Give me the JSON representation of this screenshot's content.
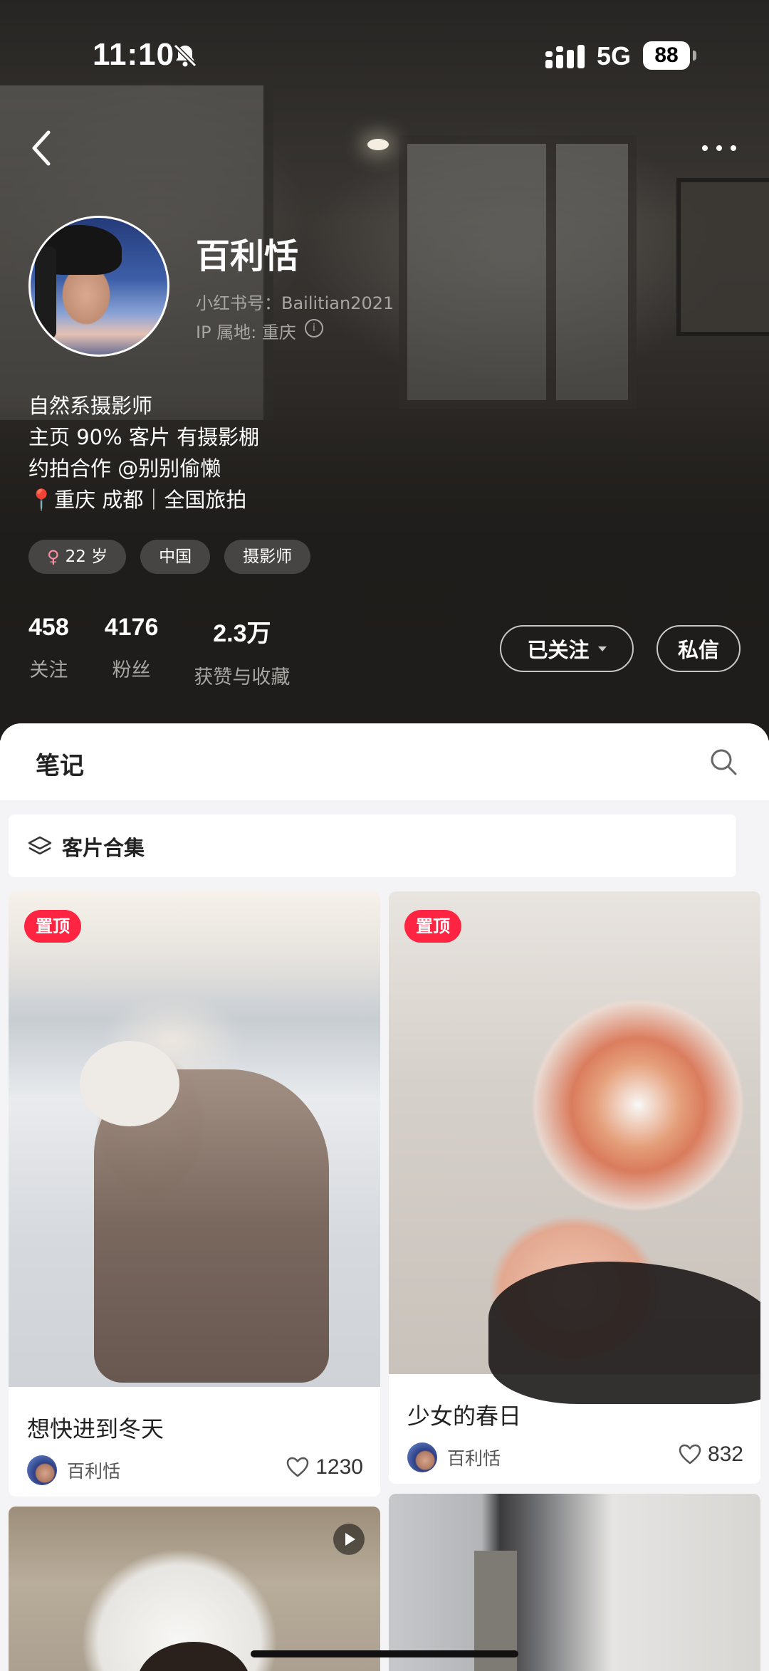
{
  "status_bar": {
    "time": "11:10",
    "network": "5G",
    "battery": "88"
  },
  "profile": {
    "nickname": "百利恬",
    "red_id": "小红书号：Bailitian2021",
    "ip_location": "IP 属地: 重庆",
    "bio_lines": [
      "自然系摄影师",
      "主页 90% 客片 有摄影棚",
      "约拍合作 @别别偷懒",
      "重庆 成都｜全国旅拍"
    ],
    "tags": [
      "22 岁",
      "中国",
      "摄影师"
    ],
    "stats": [
      {
        "value": "458",
        "label": "关注"
      },
      {
        "value": "4176",
        "label": "粉丝"
      },
      {
        "value": "2.3万",
        "label": "获赞与收藏"
      }
    ],
    "follow_button": "已关注",
    "message_button": "私信"
  },
  "tabs": {
    "notes": "笔记"
  },
  "collection": {
    "label": "客片合集"
  },
  "notes": [
    {
      "pinned_label": "置顶",
      "title": "想快进到冬天",
      "author": "百利恬",
      "likes": "1230"
    },
    {
      "pinned_label": "置顶",
      "title": "少女的春日",
      "author": "百利恬",
      "likes": "832"
    }
  ],
  "colors": {
    "accent": "#ff2442",
    "header_bg": "#1f1d1b",
    "sheet_bg": "#f4f4f6"
  }
}
